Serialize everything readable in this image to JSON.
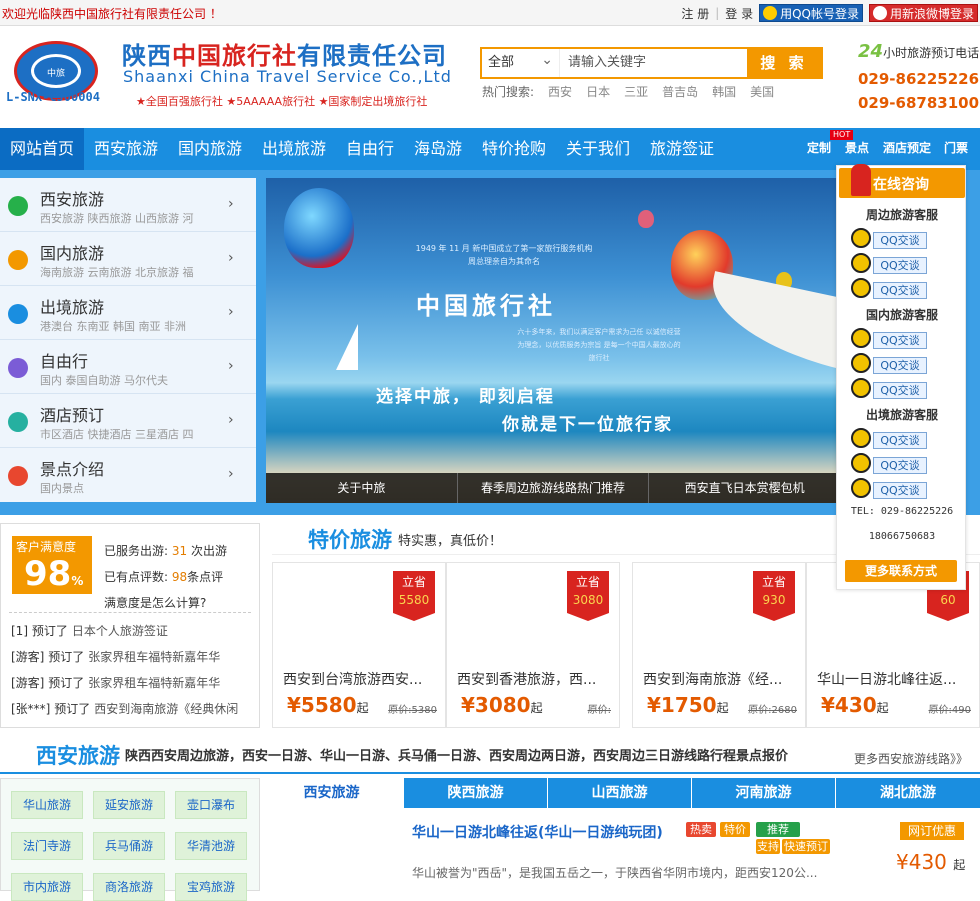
{
  "topbar": {
    "welcome": "欢迎光临陕西中国旅行社有限责任公司 ！",
    "register": "注 册",
    "login": "登 录",
    "qq_login": "用QQ帐号登录",
    "weibo_login": "用新浪微博登录"
  },
  "header": {
    "logo_code": "L-SNX-CJ00004",
    "name_cn_pre": "陕西",
    "name_cn_mid": "中国旅行社",
    "name_cn_post": "有限责任公司",
    "name_en": "Shaanxi China Travel Service Co.,Ltd",
    "tagline": "★全国百强旅行社 ★5AAAAA旅行社 ★国家制定出境旅行社",
    "logo_inner": "中旅"
  },
  "search": {
    "category": "全部",
    "placeholder": "请输入关键字",
    "button": "搜 索",
    "hot_label": "热门搜索:",
    "hot": [
      "西安",
      "日本",
      "三亚",
      "普吉岛",
      "韩国",
      "美国"
    ]
  },
  "hotline": {
    "h24_num": "24",
    "h24_text": "小时旅游预订电话",
    "phones": [
      "029-86225226",
      "029-68783100"
    ]
  },
  "nav": {
    "items": [
      "网站首页",
      "西安旅游",
      "国内旅游",
      "出境旅游",
      "自由行",
      "海岛游",
      "特价抢购",
      "关于我们",
      "旅游签证"
    ],
    "subs": [
      "定制",
      "景点",
      "酒店预定",
      "门票"
    ],
    "hot_badge": "HOT"
  },
  "sidemenu": [
    {
      "title": "西安旅游",
      "sub": "西安旅游   陕西旅游   山西旅游   河"
    },
    {
      "title": "国内旅游",
      "sub": "海南旅游   云南旅游   北京旅游   福"
    },
    {
      "title": "出境旅游",
      "sub": "港澳台   东南亚   韩国   南亚   非洲"
    },
    {
      "title": "自由行",
      "sub": "国内   泰国自助游   马尔代夫"
    },
    {
      "title": "酒店预订",
      "sub": "市区酒店   快捷酒店   三星酒店   四"
    },
    {
      "title": "景点介绍",
      "sub": "国内景点"
    }
  ],
  "banner": {
    "brand": "中国旅行社",
    "caption": "1949 年 11 月 新中国成立了第一家旅行服务机构 周总理亲自为其命名",
    "caption2": "六十多年来，我们以满足客户需求为己任 以诚信经营为理念，以优质服务为宗旨 是每一个中国人最放心的旅行社",
    "slogan1": "选择中旅， 即刻启程",
    "slogan2": "你就是下一位旅行家",
    "tabs": [
      "关于中旅",
      "春季周边旅游线路热门推荐",
      "西安直飞日本赏樱包机"
    ]
  },
  "consult": {
    "title": "在线咨询",
    "groups": [
      "周边旅游客服",
      "国内旅游客服",
      "出境旅游客服"
    ],
    "qq_label": "QQ交谈",
    "tel": "TEL: 029-86225226",
    "mobile": "18066750683",
    "more": "更多联系方式"
  },
  "stats": {
    "satis_label": "客户满意度",
    "satis_value": "98",
    "satis_unit": "%",
    "served_pre": "已服务出游:",
    "served_num": "31",
    "served_post": "次出游",
    "rated_pre": "已有点评数:",
    "rated_num": "98",
    "rated_post": "条点评",
    "howcalc": "满意度是怎么计算?",
    "orders": [
      {
        "user": "[1]",
        "act": "预订了",
        "item": "日本个人旅游签证"
      },
      {
        "user": "[游客]",
        "act": "预订了",
        "item": "张家界租车福特新嘉年华"
      },
      {
        "user": "[游客]",
        "act": "预订了",
        "item": "张家界租车福特新嘉年华"
      },
      {
        "user": "[张***]",
        "act": "预订了",
        "item": "西安到海南旅游《经典休闲"
      }
    ]
  },
  "special": {
    "title": "特价旅游",
    "subtitle": "特实惠，真低价！",
    "tag_label": "立省",
    "price_suffix": "起",
    "orig_label": "原价:",
    "cards": [
      {
        "name": "西安到台湾旅游西安...",
        "price": "¥5580",
        "orig": "5380",
        "save": "5580"
      },
      {
        "name": "西安到香港旅游，西...",
        "price": "¥3080",
        "orig": "",
        "save": "3080"
      },
      {
        "name": "西安到海南旅游《经...",
        "price": "¥1750",
        "orig": "2680",
        "save": "930"
      },
      {
        "name": "华山一日游北峰往返...",
        "price": "¥430",
        "orig": "490",
        "save": "60"
      }
    ]
  },
  "xian": {
    "title": "西安旅游",
    "desc": "陕西西安周边旅游，西安一日游、华山一日游、兵马俑一日游、西安周边两日游，西安周边三日游线路行程景点报价",
    "more": "更多西安旅游线路》》",
    "buttons": [
      "华山旅游",
      "延安旅游",
      "壶口瀑布",
      "法门寺游",
      "兵马俑游",
      "华清池游",
      "市内旅游",
      "商洛旅游",
      "宝鸡旅游"
    ],
    "tabs": [
      "西安旅游",
      "陕西旅游",
      "山西旅游",
      "河南旅游",
      "湖北旅游"
    ],
    "product": {
      "name": "华山一日游北峰往返(华山一日游纯玩团)",
      "badges": [
        "热卖",
        "特价",
        "推荐",
        "支持",
        "快速预订"
      ],
      "desc": "华山被誉为\"西岳\"，是我国五岳之一，于陕西省华阴市境内，距西安120公...",
      "online": "网订优惠",
      "price": "¥430",
      "suffix": "起"
    }
  },
  "colors": {
    "primary": "#1a8ee0",
    "accent": "#f39800",
    "red": "#d8241f",
    "price": "#e35a00"
  }
}
